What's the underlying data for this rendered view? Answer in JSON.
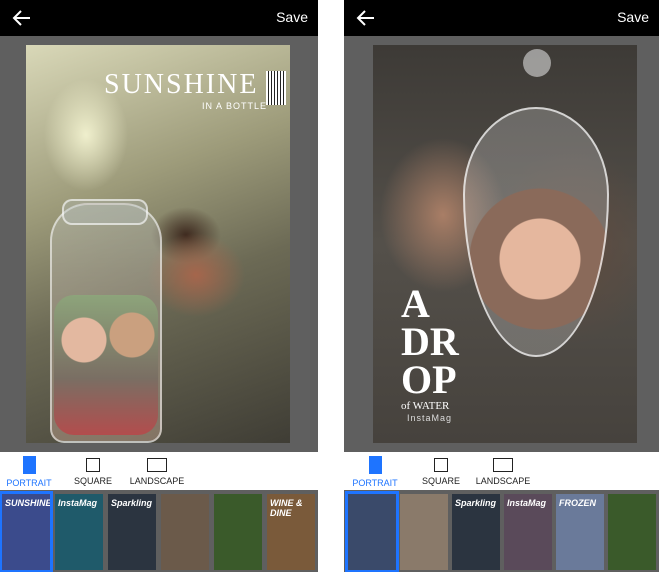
{
  "left_screen": {
    "save_label": "Save",
    "template": {
      "title": "SUNSHINE",
      "subtitle": "IN A BOTTLE"
    },
    "tabs": [
      {
        "label": "PORTRAIT",
        "active": true
      },
      {
        "label": "SQUARE",
        "active": false
      },
      {
        "label": "LANDSCAPE",
        "active": false
      }
    ],
    "thumbnails": [
      {
        "text": "SUNSHINE",
        "color": "#3b4b8c"
      },
      {
        "text": "InstaMag",
        "color": "#1f5a6a"
      },
      {
        "text": "Sparkling",
        "color": "#2b3440"
      },
      {
        "text": "",
        "color": "#6b5a4a"
      },
      {
        "text": "",
        "color": "#3a5a2a"
      },
      {
        "text": "WINE & DINE",
        "color": "#7a5a3a"
      }
    ]
  },
  "right_screen": {
    "save_label": "Save",
    "template": {
      "line1": "A",
      "line2": "DR",
      "line3": "OP",
      "small": "of WATER",
      "brand": "InstaMag"
    },
    "tabs": [
      {
        "label": "PORTRAIT",
        "active": true
      },
      {
        "label": "SQUARE",
        "active": false
      },
      {
        "label": "LANDSCAPE",
        "active": false
      }
    ],
    "thumbnails": [
      {
        "text": "",
        "color": "#3a4a6a"
      },
      {
        "text": "",
        "color": "#8a7a6a"
      },
      {
        "text": "Sparkling",
        "color": "#2b3440"
      },
      {
        "text": "InstaMag",
        "color": "#5a4a5a"
      },
      {
        "text": "FROZEN",
        "color": "#6a7a9a"
      },
      {
        "text": "",
        "color": "#3a5a2a"
      }
    ]
  },
  "colors": {
    "accent": "#1e74ff",
    "topbar": "#000000",
    "canvas_bg": "#5f5f5f"
  }
}
